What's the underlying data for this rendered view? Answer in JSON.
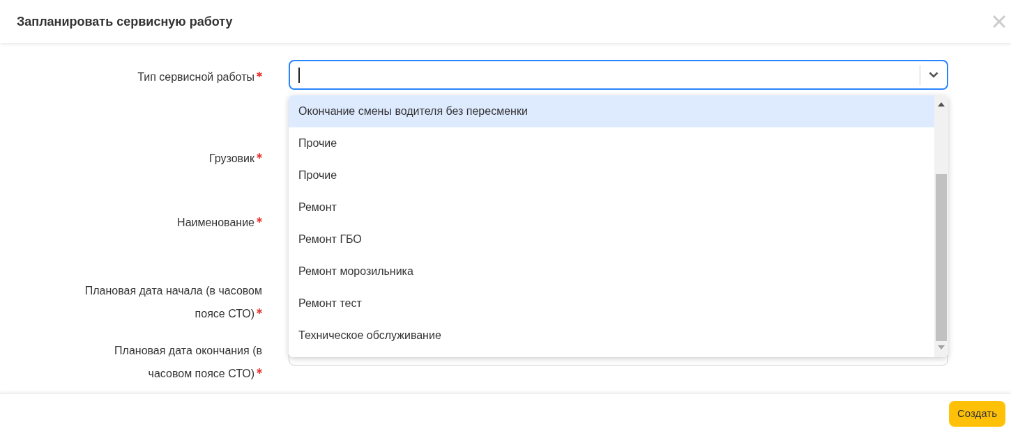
{
  "dialog": {
    "title": "Запланировать сервисную работу"
  },
  "fields": [
    {
      "label": "Тип сервисной работы",
      "required": true,
      "kind": "select"
    },
    {
      "label": "Грузовик",
      "required": true,
      "kind": "hidden"
    },
    {
      "label": "Наименование",
      "required": true,
      "kind": "hidden"
    },
    {
      "label": "Плановая дата начала (в часовом поясе СТО)",
      "required": true,
      "kind": "hidden"
    },
    {
      "label": "Плановая дата окончания (в часовом поясе СТО)",
      "required": true,
      "kind": "date"
    }
  ],
  "dropdown_options": [
    {
      "label": "Окончание смены водителя без пересменки",
      "selected": true
    },
    {
      "label": "Прочие",
      "selected": false
    },
    {
      "label": "Прочие",
      "selected": false
    },
    {
      "label": "Ремонт",
      "selected": false
    },
    {
      "label": "Ремонт ГБО",
      "selected": false
    },
    {
      "label": "Ремонт морозильника",
      "selected": false
    },
    {
      "label": "Ремонт тест",
      "selected": false
    },
    {
      "label": "Техническое обслуживание",
      "selected": false
    }
  ],
  "footer": {
    "submit": "Создать"
  }
}
